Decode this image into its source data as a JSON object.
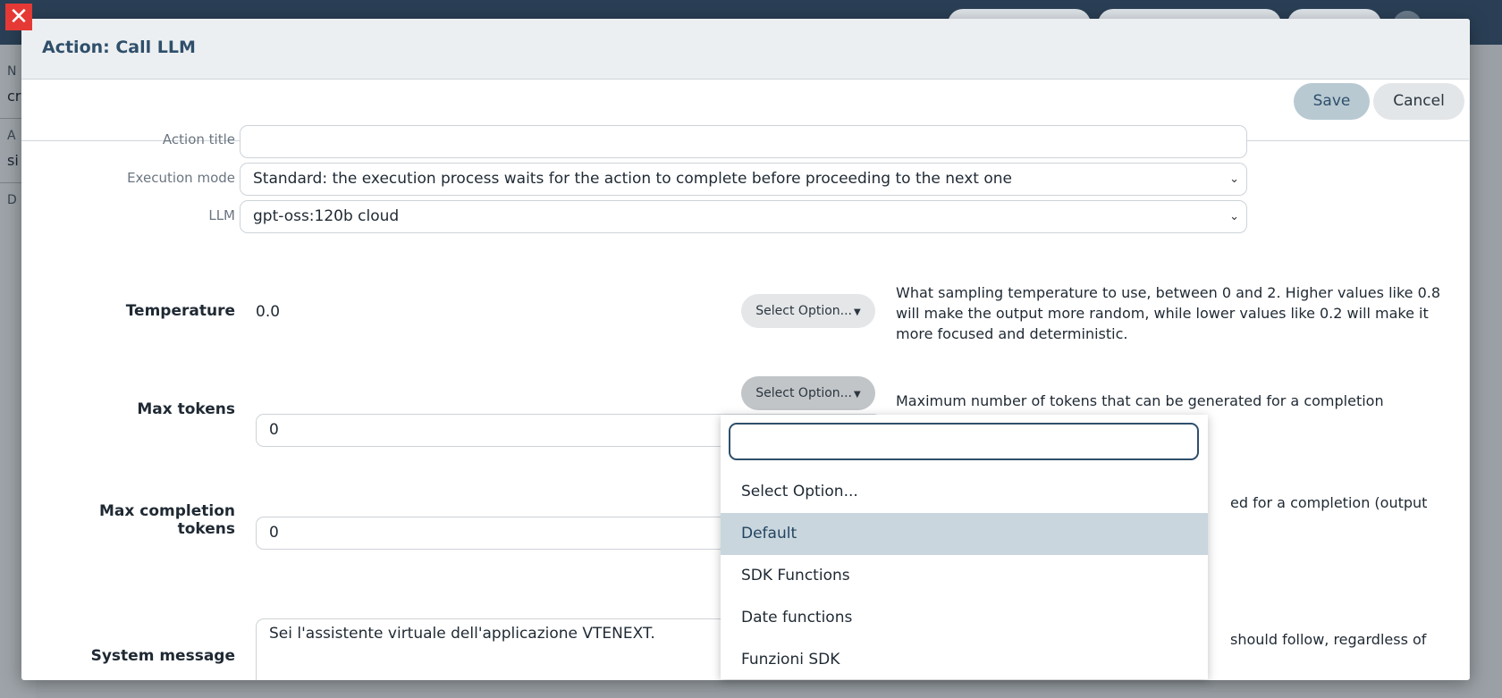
{
  "background": {
    "left_labels": [
      "N",
      "cr",
      "A",
      "si",
      "D"
    ]
  },
  "modal": {
    "title": "Action: Call LLM",
    "save_label": "Save",
    "cancel_label": "Cancel",
    "close_glyph": "✕"
  },
  "form": {
    "action_title": {
      "label": "Action title",
      "value": ""
    },
    "execution_mode": {
      "label": "Execution mode",
      "value": "Standard: the execution process waits for the action to complete before proceeding to the next one"
    },
    "llm": {
      "label": "LLM",
      "value": "gpt-oss:120b cloud"
    },
    "temperature": {
      "label": "Temperature",
      "value": "0.0",
      "option_button": "Select Option...",
      "description": "What sampling temperature to use, between 0 and 2. Higher values like 0.8 will make the output more random, while lower values like 0.2 will make it more focused and deterministic."
    },
    "max_tokens": {
      "label": "Max tokens",
      "value": "0",
      "option_button": "Select Option...",
      "description": "Maximum number of tokens that can be generated for a completion (reasoning + output)"
    },
    "max_completion_tokens": {
      "label": "Max completion tokens",
      "value": "0",
      "description_visible": "ed for a completion (output"
    },
    "system_message": {
      "label": "System message",
      "value": "Sei l'assistente virtuale dell'applicazione VTENEXT.",
      "description_visible": "should follow, regardless of"
    }
  },
  "dropdown": {
    "search_value": "",
    "items": [
      {
        "label": "Select Option...",
        "active": false
      },
      {
        "label": "Default",
        "active": true
      },
      {
        "label": "SDK Functions",
        "active": false
      },
      {
        "label": "Date functions",
        "active": false
      },
      {
        "label": "Funzioni SDK",
        "active": false
      }
    ]
  },
  "icons": {
    "close": "close-icon",
    "select_chevron": "chevron-down-icon",
    "button_caret": "caret-down-icon"
  },
  "colors": {
    "header_title": "#2f4f6b",
    "save_bg": "#b8c9d2",
    "active_option_bg": "#c9d6de",
    "close_red": "#e53935"
  }
}
